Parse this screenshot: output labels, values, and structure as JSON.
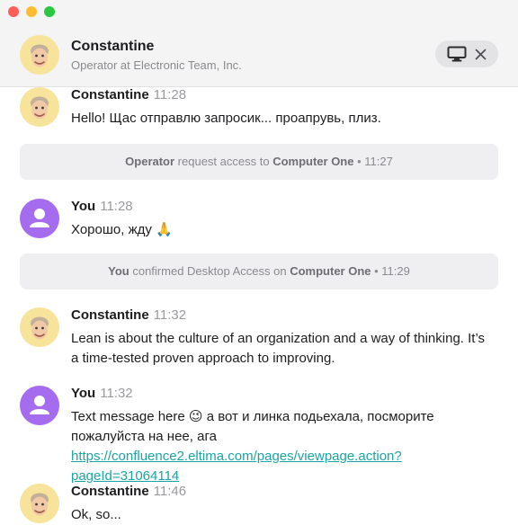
{
  "window": {
    "traffic_lights": [
      "close",
      "minimize",
      "zoom"
    ]
  },
  "header": {
    "name": "Constantine",
    "subtitle": "Operator at Electronic Team, Inc.",
    "icons": [
      "desktop-icon",
      "close-icon"
    ]
  },
  "colors": {
    "link": "#1aa5a2",
    "you_avatar": "#a56cf0",
    "system_bg": "#efeff1"
  },
  "messages": [
    {
      "author": "Constantine",
      "time": "11:28",
      "text": "Hello! Щас отправлю запросик... проапрувь, плиз."
    },
    {
      "system_actor": "Operator",
      "system_mid": " request access to ",
      "system_target": "Computer One",
      "system_time": " • 11:27"
    },
    {
      "author": "You",
      "time": "11:28",
      "text": "Хорошо, жду 🙏"
    },
    {
      "system_actor": "You",
      "system_mid": " confirmed Desktop Access on ",
      "system_target": "Computer One",
      "system_time": " • 11:29"
    },
    {
      "author": "Constantine",
      "time": "11:32",
      "text": "Lean is about the culture of an organization and a way of thinking. It’s a time-tested proven approach to improving."
    },
    {
      "author": "You",
      "time": "11:32",
      "text_before": "Text message here 😉 а вот и линка подьехала, посморите пожалуйста на нее, ага ",
      "link": "https://confluence2.eltima.com/pages/viewpage.action?pageId=31064114"
    },
    {
      "author": "Constantine",
      "time": "11:46",
      "text": "Ok, so..."
    }
  ]
}
